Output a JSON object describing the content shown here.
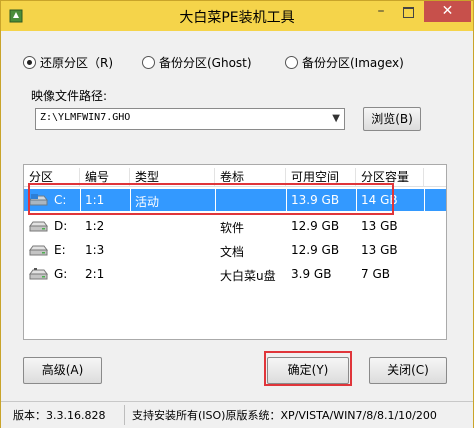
{
  "window": {
    "title": "大白菜PE装机工具",
    "min_label": "–",
    "close_label": "✕"
  },
  "mode": {
    "options": [
      {
        "label": "还原分区（R)",
        "checked": true
      },
      {
        "label": "备份分区(Ghost)",
        "checked": false
      },
      {
        "label": "备份分区(Imagex)",
        "checked": false
      }
    ]
  },
  "image": {
    "label": "映像文件路径:",
    "path": "Z:\\YLMFWIN7.GHO",
    "browse_label": "浏览(B)"
  },
  "table": {
    "columns": [
      "分区",
      "编号",
      "类型",
      "卷标",
      "可用空间",
      "分区容量"
    ],
    "rows": [
      {
        "drive": "C:",
        "num": "1:1",
        "type": "活动",
        "label": "",
        "free": "13.9 GB",
        "size": "14 GB",
        "selected": true
      },
      {
        "drive": "D:",
        "num": "1:2",
        "type": "",
        "label": "软件",
        "free": "12.9 GB",
        "size": "13 GB",
        "selected": false
      },
      {
        "drive": "E:",
        "num": "1:3",
        "type": "",
        "label": "文档",
        "free": "12.9 GB",
        "size": "13 GB",
        "selected": false
      },
      {
        "drive": "G:",
        "num": "2:1",
        "type": "",
        "label": "大白菜u盘",
        "free": "3.9 GB",
        "size": "7 GB",
        "selected": false
      }
    ]
  },
  "buttons": {
    "advanced": "高级(A)",
    "ok": "确定(Y)",
    "close": "关闭(C)"
  },
  "status": {
    "version": "版本：3.3.16.828",
    "support": "支持安装所有(ISO)原版系统：XP/VISTA/WIN7/8/8.1/10/200"
  },
  "colors": {
    "titlebar": "#f5d44a",
    "selection": "#3399ff",
    "highlight": "#e0353a",
    "close_button": "#c7504b"
  }
}
